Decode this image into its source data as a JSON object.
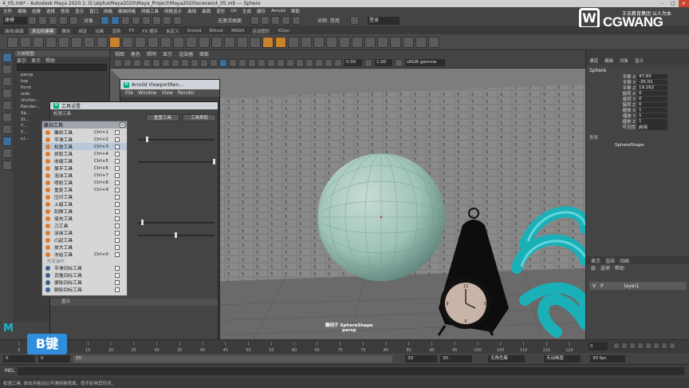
{
  "title_bar": {
    "title": "4_05.mb* - Autodesk Maya 2020.1: D:\\alpha\\Maya2020\\Maya_Project\\Maya2020\\scenes\\4_05.mb  ---  Sphere",
    "controls": [
      "–",
      "□",
      "×"
    ]
  },
  "menu_bar": [
    "文件",
    "编辑",
    "创建",
    "选择",
    "修改",
    "显示",
    "窗口",
    "网格",
    "编辑网格",
    "网格工具",
    "网格显示",
    "曲线",
    "曲面",
    "变形",
    "UV",
    "生成",
    "缓存",
    "Arnold",
    "帮助"
  ],
  "status_line": {
    "mode": "建模",
    "object_label": "对象",
    "surface_label": "无激活曲面",
    "symmetry_label": "对称: 禁用",
    "login_label": "登录"
  },
  "shelf_tabs": [
    "曲线/曲面",
    "多边形建模",
    "雕刻",
    "绑定",
    "动画",
    "渲染",
    "FX",
    "FX 缓存",
    "自定义",
    "Arnold",
    "Bifrost",
    "MASH",
    "运动图形",
    "XGen"
  ],
  "shelf_active": "多边形建模",
  "logo": {
    "mark": "W",
    "brand": "CGWANG",
    "slogan": "王氏教育集团 以人为本"
  },
  "outliner": {
    "title": "大纲视图",
    "menu": [
      "显示",
      "显示",
      "帮助"
    ],
    "items": [
      "persp",
      "top",
      "front",
      "side",
      "shchor...",
      "Render...",
      "Sp...",
      "St...",
      "T...",
      "T...",
      "ui..."
    ]
  },
  "viewport": {
    "menu": [
      "视图",
      "着色",
      "照明",
      "显示",
      "渲染器",
      "面板"
    ],
    "field_a": "0.00",
    "field_b": "1.00",
    "color_space": "sRGB gamma",
    "object_label": "雕刻子 SphereShape",
    "camera_label": "persp"
  },
  "channel_box": {
    "tabs": [
      "通道",
      "编辑",
      "对象",
      "显示"
    ],
    "object": "Sphere",
    "attributes": [
      {
        "label": "平移 X",
        "value": "47.65"
      },
      {
        "label": "平移 Y",
        "value": "-35.01"
      },
      {
        "label": "平移 Z",
        "value": "19.262"
      },
      {
        "label": "旋转 X",
        "value": "0"
      },
      {
        "label": "旋转 Y",
        "value": "0"
      },
      {
        "label": "旋转 Z",
        "value": "0"
      },
      {
        "label": "缩放 X",
        "value": "1"
      },
      {
        "label": "缩放 Y",
        "value": "1"
      },
      {
        "label": "缩放 Z",
        "value": "1"
      },
      {
        "label": "可见性",
        "value": "启用"
      }
    ],
    "shapes_header": "形状",
    "shape": "SphereShape",
    "layer_tabs": [
      "显示",
      "渲染",
      "动画"
    ],
    "layer_menu": [
      "层",
      "选项",
      "帮助"
    ],
    "layer": {
      "v": "V",
      "p": "P",
      "name": "layer1"
    }
  },
  "arnold_window": {
    "title": "Arnold ViewportRen...",
    "menu": [
      "File",
      "Window",
      "View",
      "Render"
    ]
  },
  "tool_settings": {
    "title": "工具设置",
    "tool_name": "松弛工具",
    "reset_button": "重置工具",
    "help_button": "工具帮助",
    "display_section": "显示"
  },
  "sculpt_menu": {
    "title": "雕刻工具",
    "items": [
      {
        "name": "雕刻工具",
        "shortcut": "Ctrl+1"
      },
      {
        "name": "平滑工具",
        "shortcut": "Ctrl+2"
      },
      {
        "name": "松弛工具",
        "shortcut": "Ctrl+3"
      },
      {
        "name": "抓取工具",
        "shortcut": "Ctrl+4"
      },
      {
        "name": "收缩工具",
        "shortcut": "Ctrl+5"
      },
      {
        "name": "展平工具",
        "shortcut": "Ctrl+6"
      },
      {
        "name": "泡沫工具",
        "shortcut": "Ctrl+7"
      },
      {
        "name": "喷射工具",
        "shortcut": "Ctrl+8"
      },
      {
        "name": "重复工具",
        "shortcut": "Ctrl+9"
      },
      {
        "name": "压印工具",
        "shortcut": ""
      },
      {
        "name": "上蜡工具",
        "shortcut": ""
      },
      {
        "name": "刮擦工具",
        "shortcut": ""
      },
      {
        "name": "填充工具",
        "shortcut": ""
      },
      {
        "name": "刀工具",
        "shortcut": ""
      },
      {
        "name": "涂抹工具",
        "shortcut": ""
      },
      {
        "name": "凸起工具",
        "shortcut": ""
      },
      {
        "name": "放大工具",
        "shortcut": ""
      },
      {
        "name": "冻结工具",
        "shortcut": "Ctrl+0"
      }
    ],
    "section": "形变操作",
    "target_items": [
      "平滑目标工具",
      "克隆目标工具",
      "擦除目标工具",
      "删除目标工具"
    ]
  },
  "timeline": {
    "ticks": [
      "0",
      "5",
      "10",
      "15",
      "20",
      "25",
      "30",
      "35",
      "40",
      "45",
      "50",
      "55",
      "60",
      "65",
      "70",
      "75",
      "80",
      "85",
      "90",
      "95",
      "100",
      "105",
      "110",
      "115",
      "120"
    ],
    "current_frame": "0"
  },
  "range": {
    "start": "0",
    "inner_start": "0",
    "inner_end": "30",
    "end": "30",
    "end2": "30",
    "character_set": "无角色集",
    "anim_layer": "无动画层",
    "fps": "30 fps"
  },
  "mel_label": "MEL",
  "help_line": "松弛工具: 单击并拖动以平滑网格表面，而不影响其形状。",
  "overlay_key": "B键",
  "colors": {
    "accent": "#2f8fdc",
    "sphere": "#9ec3b8",
    "knot": "#1ab0b8",
    "menu_bg": "#d6d6d6",
    "tool_dot": "#e07b2a"
  }
}
